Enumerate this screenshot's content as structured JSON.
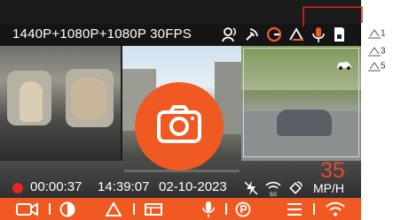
{
  "status_bar": {
    "resolution_label": "1440P+1080P+1080P 30FPS",
    "icons": [
      "voice-control-icon",
      "gps-signal-icon",
      "g-sensor-icon",
      "parking-mode-icon",
      "microphone-icon",
      "sd-card-icon"
    ]
  },
  "rear_camera_badge": "car-icon",
  "center_button": {
    "icon": "camera-icon"
  },
  "recording": {
    "elapsed": "00:00:37",
    "time": "14:39:07",
    "date": "02-10-2023"
  },
  "status_icons": [
    "flash-off-icon",
    "wifi-5g-icon",
    "satellite-icon"
  ],
  "speed": {
    "value": "35",
    "unit": "MP/H"
  },
  "toolbar": {
    "buttons": [
      "video-camera-icon",
      "exposure-icon",
      "warning-triangle-icon",
      "screen-layout-icon",
      "microphone-icon",
      "parking-icon",
      "menu-icon",
      "wifi-icon"
    ]
  },
  "callouts": {
    "a": "1",
    "b": "3",
    "c": "5"
  },
  "colors": {
    "accent": "#f05a22",
    "record": "#e4261b",
    "speed": "#e8472a"
  }
}
